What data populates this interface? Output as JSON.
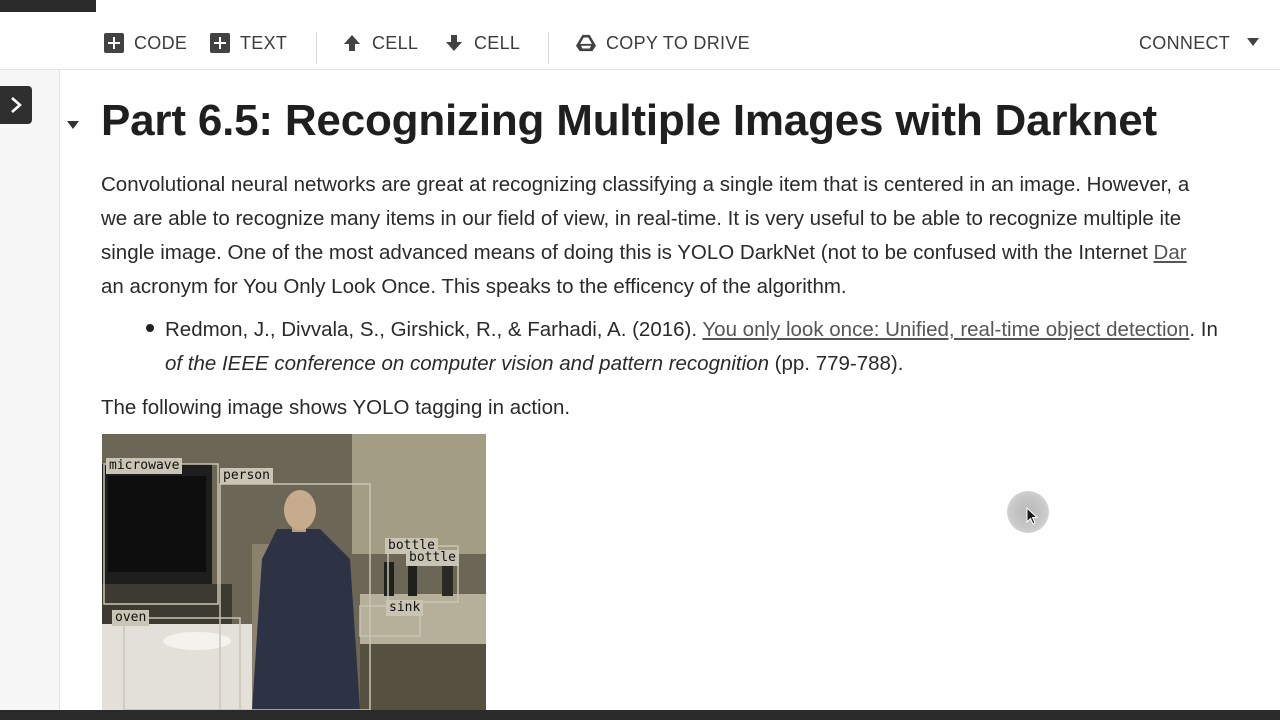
{
  "toolbar": {
    "code_label": "CODE",
    "text_label": "TEXT",
    "cell_up_label": "CELL",
    "cell_down_label": "CELL",
    "copy_to_drive_label": "COPY TO DRIVE",
    "connect_label": "CONNECT"
  },
  "icons": {
    "code": "plus-box-icon",
    "text": "plus-box-icon",
    "cell_up": "arrow-up-icon",
    "cell_down": "arrow-down-icon",
    "drive": "google-drive-icon",
    "connect_dropdown": "caret-down-icon",
    "sidebar": "chevron-right-icon",
    "collapse": "caret-down-icon"
  },
  "notebook": {
    "heading": "Part 6.5: Recognizing Multiple Images with Darknet",
    "paragraph_lines": [
      "Convolutional neural networks are great at recognizing classifying a single item that is centered in an image. However, a",
      "we are able to recognize many items in our field of view, in real-time. It is very useful to be able to recognize multiple ite",
      "single image. One of the most advanced means of doing this is YOLO DarkNet (not to be confused with the Internet ",
      "an acronym for You Only Look Once. This speaks to the efficency of the algorithm."
    ],
    "paragraph_link_fragment": "Dar",
    "citation": {
      "authors": "Redmon, J., Divvala, S., Girshick, R., & Farhadi, A. (2016). ",
      "title_link": "You only look once: Unified, real-time object detection",
      "after_link": ". In",
      "venue": "of the IEEE conference on computer vision and pattern recognition",
      "pages": " (pp. 779-788)."
    },
    "image_caption": "The following image shows YOLO tagging in action.",
    "image_labels": [
      "microwave",
      "person",
      "bottle",
      "bottle",
      "sink",
      "oven"
    ]
  },
  "colors": {
    "toolbar_text": "#3c3c3c",
    "heading": "#1f1f1f",
    "link": "#555555",
    "detection_box": "#c9c4b3"
  }
}
